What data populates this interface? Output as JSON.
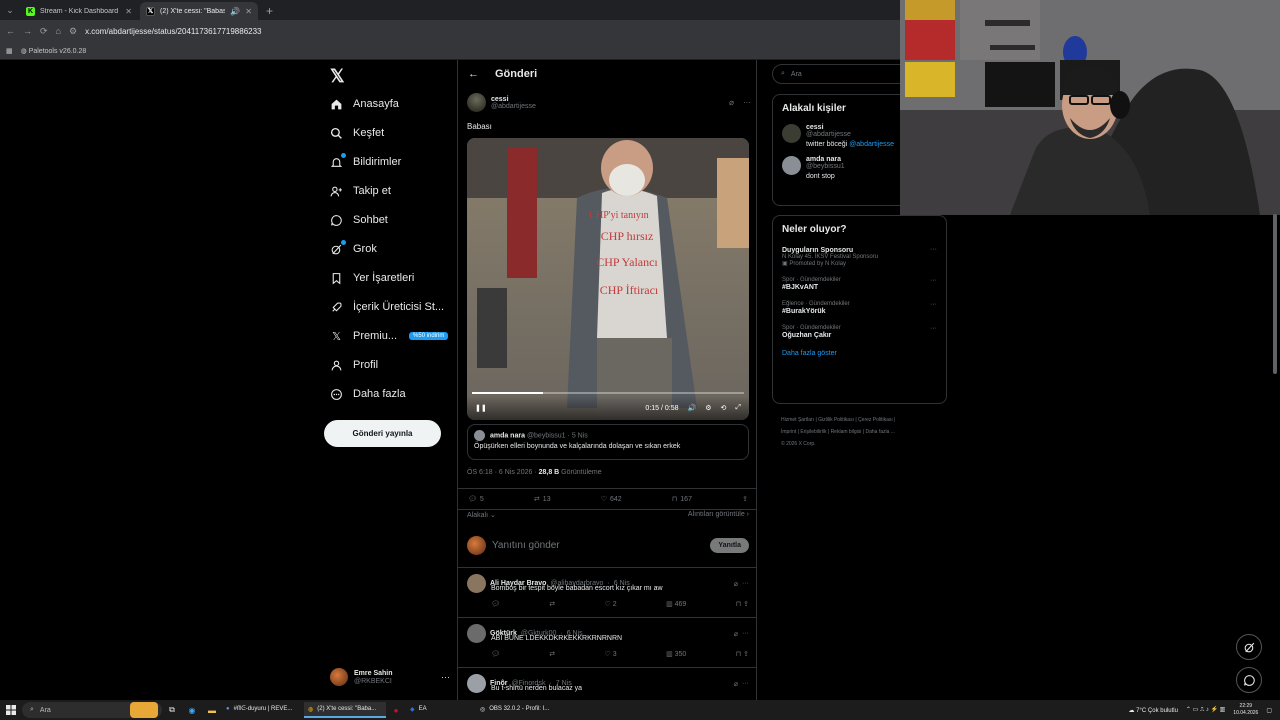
{
  "browser": {
    "tabs": [
      {
        "title": "Stream - Kick Dashboard",
        "active": false
      },
      {
        "title": "(2) X'te cessi: \"Babası https:...",
        "active": true
      }
    ],
    "url": "x.com/abdartijesse/status/2041173617719886233",
    "bookmark": "Paletools v26.0.28"
  },
  "nav": {
    "items": [
      {
        "label": "Anasayfa",
        "icon": "home-icon"
      },
      {
        "label": "Keşfet",
        "icon": "search-icon"
      },
      {
        "label": "Bildirimler",
        "icon": "bell-icon"
      },
      {
        "label": "Takip et",
        "icon": "add-user-icon"
      },
      {
        "label": "Sohbet",
        "icon": "chat-icon"
      },
      {
        "label": "Grok",
        "icon": "grok-icon"
      },
      {
        "label": "Yer İşaretleri",
        "icon": "bookmark-icon"
      },
      {
        "label": "İçerik Üreticisi St...",
        "icon": "rocket-icon"
      },
      {
        "label": "Premiu...",
        "icon": "x-icon"
      },
      {
        "label": "Profil",
        "icon": "person-icon"
      },
      {
        "label": "Daha fazla",
        "icon": "more-circle-icon"
      }
    ],
    "promo_badge": "%50 indirim",
    "post_button": "Gönderi yayınla",
    "account": {
      "name": "Emre Sahin",
      "handle": "@RKBEKCI"
    }
  },
  "post": {
    "header": "Gönderi",
    "author_name": "cessi",
    "author_handle": "@abdartijesse",
    "text": "Babası",
    "video": {
      "time": "0:15 / 0:58",
      "progress": 0.26,
      "shirt_text": [
        "CHP'yi tanıyın",
        "CHP hırsız",
        "CHP Yalancı",
        "CHP İftiracı"
      ]
    },
    "quote": {
      "name": "amda nara",
      "handle": "@beybissu1",
      "age": "5 Nis",
      "text": "Öpüşürken elleri boynunda ve kalçalarında dolaşan ve sıkan erkek"
    },
    "meta_time": "ÖS 6:18 · 6 Nis 2026 · ",
    "views_count": "28,8 B",
    "views_label": " Görüntüleme",
    "stats": {
      "replies": "5",
      "reposts": "13",
      "likes": "642",
      "bookmarks": "167"
    },
    "relevant_label": "Alakalı",
    "view_quotes": "Alıntıları görüntüle",
    "reply_placeholder": "Yanıtını gönder",
    "reply_button": "Yanıtla"
  },
  "replies": [
    {
      "name": "Ali Haydar Bravo",
      "handle": "@alihaydarbravo",
      "age": "6 Nis",
      "text": "Bomboş bir tespit böyle babadan escort kız çıkar mı aw",
      "likes": "2",
      "views": "469",
      "avatar_color": "#8a7560"
    },
    {
      "name": "Göktürk",
      "handle": "@Gkturk00",
      "age": "6 Nis",
      "text": "ABİ BUNE LDEKKDKRKEKKRKRNRNRN",
      "likes": "3",
      "views": "350",
      "avatar_color": "#6b6b6b"
    },
    {
      "name": "Finôr",
      "handle": "@Finordsk",
      "age": "7 Nis",
      "text": "Bu t-shirtü nerden bulacaz ya",
      "likes": "",
      "views": "",
      "avatar_color": "#9aa0a6"
    }
  ],
  "right": {
    "search_placeholder": "Ara",
    "related_title": "Alakalı kişiler",
    "related": [
      {
        "name": "cessi",
        "handle": "@abdartijesse",
        "bio": "twitter böceği ",
        "bio_link": "@abdartijesse",
        "avatar_color": "#3b3d32"
      },
      {
        "name": "amda nara",
        "handle": "@beybissu1",
        "bio": "dont stop",
        "bio_link": "",
        "avatar_color": "#8a8f96"
      }
    ],
    "trends_title": "Neler oluyor?",
    "trends": [
      {
        "category": "",
        "name": "Duyguların Sponsoru",
        "sub": "N Kolay 45. İKSV Festival Sponsoru",
        "promoted": "Promoted by N Kolay"
      },
      {
        "category": "Spor · Gündemdekiler",
        "name": "#BJKvANT",
        "sub": "",
        "promoted": ""
      },
      {
        "category": "Eğlence · Gündemdekiler",
        "name": "#BurakYörük",
        "sub": "",
        "promoted": ""
      },
      {
        "category": "Spor · Gündemdekiler",
        "name": "Oğuzhan Çakır",
        "sub": "",
        "promoted": ""
      }
    ],
    "show_more": "Daha fazla göster",
    "footer": [
      "Hizmet Şartları",
      "Gizlilik Politikası",
      "Çerez Politikası",
      "İmprint",
      "Erişilebilirlik",
      "Reklam bilgisi",
      "Daha fazla ...",
      "© 2026 X Corp."
    ]
  },
  "taskbar": {
    "search": "Ara",
    "apps": [
      {
        "label": "#ᗰᕮ-duyuru | REVE...",
        "active": false
      },
      {
        "label": "(2) X'te cessi: \"Baba...",
        "active": true
      },
      {
        "label": "",
        "active": false
      },
      {
        "label": "EA",
        "active": false
      },
      {
        "label": "OBS 32.0.2 - Profil: I...",
        "active": false
      }
    ],
    "weather": "7°C  Çok bulutlu",
    "time": "22:29",
    "date": "10.04.2026"
  }
}
